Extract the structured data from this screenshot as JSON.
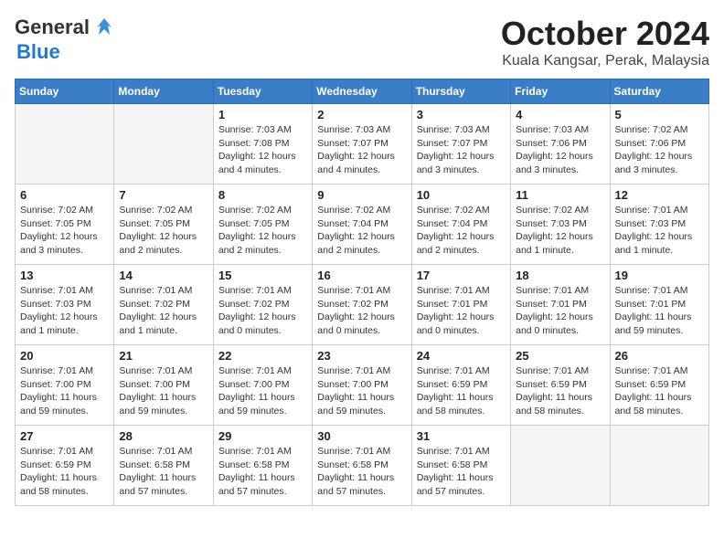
{
  "header": {
    "logo_general": "General",
    "logo_blue": "Blue",
    "month": "October 2024",
    "location": "Kuala Kangsar, Perak, Malaysia"
  },
  "weekdays": [
    "Sunday",
    "Monday",
    "Tuesday",
    "Wednesday",
    "Thursday",
    "Friday",
    "Saturday"
  ],
  "weeks": [
    [
      {
        "day": "",
        "info": ""
      },
      {
        "day": "",
        "info": ""
      },
      {
        "day": "1",
        "info": "Sunrise: 7:03 AM\nSunset: 7:08 PM\nDaylight: 12 hours\nand 4 minutes."
      },
      {
        "day": "2",
        "info": "Sunrise: 7:03 AM\nSunset: 7:07 PM\nDaylight: 12 hours\nand 4 minutes."
      },
      {
        "day": "3",
        "info": "Sunrise: 7:03 AM\nSunset: 7:07 PM\nDaylight: 12 hours\nand 3 minutes."
      },
      {
        "day": "4",
        "info": "Sunrise: 7:03 AM\nSunset: 7:06 PM\nDaylight: 12 hours\nand 3 minutes."
      },
      {
        "day": "5",
        "info": "Sunrise: 7:02 AM\nSunset: 7:06 PM\nDaylight: 12 hours\nand 3 minutes."
      }
    ],
    [
      {
        "day": "6",
        "info": "Sunrise: 7:02 AM\nSunset: 7:05 PM\nDaylight: 12 hours\nand 3 minutes."
      },
      {
        "day": "7",
        "info": "Sunrise: 7:02 AM\nSunset: 7:05 PM\nDaylight: 12 hours\nand 2 minutes."
      },
      {
        "day": "8",
        "info": "Sunrise: 7:02 AM\nSunset: 7:05 PM\nDaylight: 12 hours\nand 2 minutes."
      },
      {
        "day": "9",
        "info": "Sunrise: 7:02 AM\nSunset: 7:04 PM\nDaylight: 12 hours\nand 2 minutes."
      },
      {
        "day": "10",
        "info": "Sunrise: 7:02 AM\nSunset: 7:04 PM\nDaylight: 12 hours\nand 2 minutes."
      },
      {
        "day": "11",
        "info": "Sunrise: 7:02 AM\nSunset: 7:03 PM\nDaylight: 12 hours\nand 1 minute."
      },
      {
        "day": "12",
        "info": "Sunrise: 7:01 AM\nSunset: 7:03 PM\nDaylight: 12 hours\nand 1 minute."
      }
    ],
    [
      {
        "day": "13",
        "info": "Sunrise: 7:01 AM\nSunset: 7:03 PM\nDaylight: 12 hours\nand 1 minute."
      },
      {
        "day": "14",
        "info": "Sunrise: 7:01 AM\nSunset: 7:02 PM\nDaylight: 12 hours\nand 1 minute."
      },
      {
        "day": "15",
        "info": "Sunrise: 7:01 AM\nSunset: 7:02 PM\nDaylight: 12 hours\nand 0 minutes."
      },
      {
        "day": "16",
        "info": "Sunrise: 7:01 AM\nSunset: 7:02 PM\nDaylight: 12 hours\nand 0 minutes."
      },
      {
        "day": "17",
        "info": "Sunrise: 7:01 AM\nSunset: 7:01 PM\nDaylight: 12 hours\nand 0 minutes."
      },
      {
        "day": "18",
        "info": "Sunrise: 7:01 AM\nSunset: 7:01 PM\nDaylight: 12 hours\nand 0 minutes."
      },
      {
        "day": "19",
        "info": "Sunrise: 7:01 AM\nSunset: 7:01 PM\nDaylight: 11 hours\nand 59 minutes."
      }
    ],
    [
      {
        "day": "20",
        "info": "Sunrise: 7:01 AM\nSunset: 7:00 PM\nDaylight: 11 hours\nand 59 minutes."
      },
      {
        "day": "21",
        "info": "Sunrise: 7:01 AM\nSunset: 7:00 PM\nDaylight: 11 hours\nand 59 minutes."
      },
      {
        "day": "22",
        "info": "Sunrise: 7:01 AM\nSunset: 7:00 PM\nDaylight: 11 hours\nand 59 minutes."
      },
      {
        "day": "23",
        "info": "Sunrise: 7:01 AM\nSunset: 7:00 PM\nDaylight: 11 hours\nand 59 minutes."
      },
      {
        "day": "24",
        "info": "Sunrise: 7:01 AM\nSunset: 6:59 PM\nDaylight: 11 hours\nand 58 minutes."
      },
      {
        "day": "25",
        "info": "Sunrise: 7:01 AM\nSunset: 6:59 PM\nDaylight: 11 hours\nand 58 minutes."
      },
      {
        "day": "26",
        "info": "Sunrise: 7:01 AM\nSunset: 6:59 PM\nDaylight: 11 hours\nand 58 minutes."
      }
    ],
    [
      {
        "day": "27",
        "info": "Sunrise: 7:01 AM\nSunset: 6:59 PM\nDaylight: 11 hours\nand 58 minutes."
      },
      {
        "day": "28",
        "info": "Sunrise: 7:01 AM\nSunset: 6:58 PM\nDaylight: 11 hours\nand 57 minutes."
      },
      {
        "day": "29",
        "info": "Sunrise: 7:01 AM\nSunset: 6:58 PM\nDaylight: 11 hours\nand 57 minutes."
      },
      {
        "day": "30",
        "info": "Sunrise: 7:01 AM\nSunset: 6:58 PM\nDaylight: 11 hours\nand 57 minutes."
      },
      {
        "day": "31",
        "info": "Sunrise: 7:01 AM\nSunset: 6:58 PM\nDaylight: 11 hours\nand 57 minutes."
      },
      {
        "day": "",
        "info": ""
      },
      {
        "day": "",
        "info": ""
      }
    ]
  ]
}
